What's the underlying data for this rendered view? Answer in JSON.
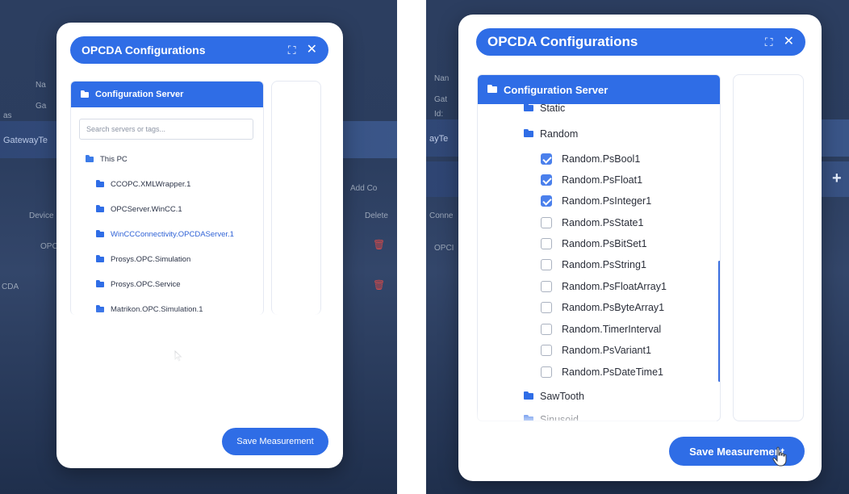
{
  "colors": {
    "accent": "#2f6de6",
    "app_background": "#2c3e60",
    "modal_background": "#ffffff",
    "delete_red": "#d34a4a"
  },
  "left_panel": {
    "background": {
      "gateway_label": "GatewayTe",
      "action_label": "Add Co",
      "column_a": "Device",
      "column_b": "Delete",
      "cell_a": "OPC",
      "cell_b": "CDA",
      "meta_a": "Na",
      "meta_b": "Ga",
      "meta_c": "as",
      "delete_icon": "trash-icon"
    },
    "modal": {
      "title": "OPCDA Configurations",
      "expand_icon": "expand-icon",
      "close_icon": "close-icon",
      "config_header": "Configuration Server",
      "search_placeholder": "Search servers or tags...",
      "tree": [
        {
          "label": "This PC",
          "level": 0
        },
        {
          "label": "CCOPC.XMLWrapper.1",
          "level": 1
        },
        {
          "label": "OPCServer.WinCC.1",
          "level": 1
        },
        {
          "label": "WinCCConnectivity.OPCDAServer.1",
          "level": 1
        },
        {
          "label": "Prosys.OPC.Simulation",
          "level": 1
        },
        {
          "label": "Prosys.OPC.Service",
          "level": 1
        },
        {
          "label": "Matrikon.OPC.Simulation.1",
          "level": 1
        }
      ],
      "save_button": "Save Measurement"
    }
  },
  "right_panel": {
    "background": {
      "meta_a": "Nan",
      "meta_b": "Gat",
      "meta_c": "Id:",
      "gateway_label": "ayTe",
      "column_a": "Conne",
      "cell_a": "OPCI",
      "add_icon": "+"
    },
    "modal": {
      "title": "OPCDA Configurations",
      "expand_icon": "expand-icon",
      "close_icon": "close-icon",
      "config_header": "Configuration Server",
      "folders_top": [
        "Static",
        "Random"
      ],
      "tags": [
        {
          "label": "Random.PsBool1",
          "checked": true
        },
        {
          "label": "Random.PsFloat1",
          "checked": true
        },
        {
          "label": "Random.PsInteger1",
          "checked": true
        },
        {
          "label": "Random.PsState1",
          "checked": false
        },
        {
          "label": "Random.PsBitSet1",
          "checked": false
        },
        {
          "label": "Random.PsString1",
          "checked": false
        },
        {
          "label": "Random.PsFloatArray1",
          "checked": false
        },
        {
          "label": "Random.PsByteArray1",
          "checked": false
        },
        {
          "label": "Random.TimerInterval",
          "checked": false
        },
        {
          "label": "Random.PsVariant1",
          "checked": false
        },
        {
          "label": "Random.PsDateTime1",
          "checked": false
        }
      ],
      "folders_bottom": [
        "SawTooth",
        "Sinusoid"
      ],
      "save_button": "Save Measurement"
    }
  }
}
